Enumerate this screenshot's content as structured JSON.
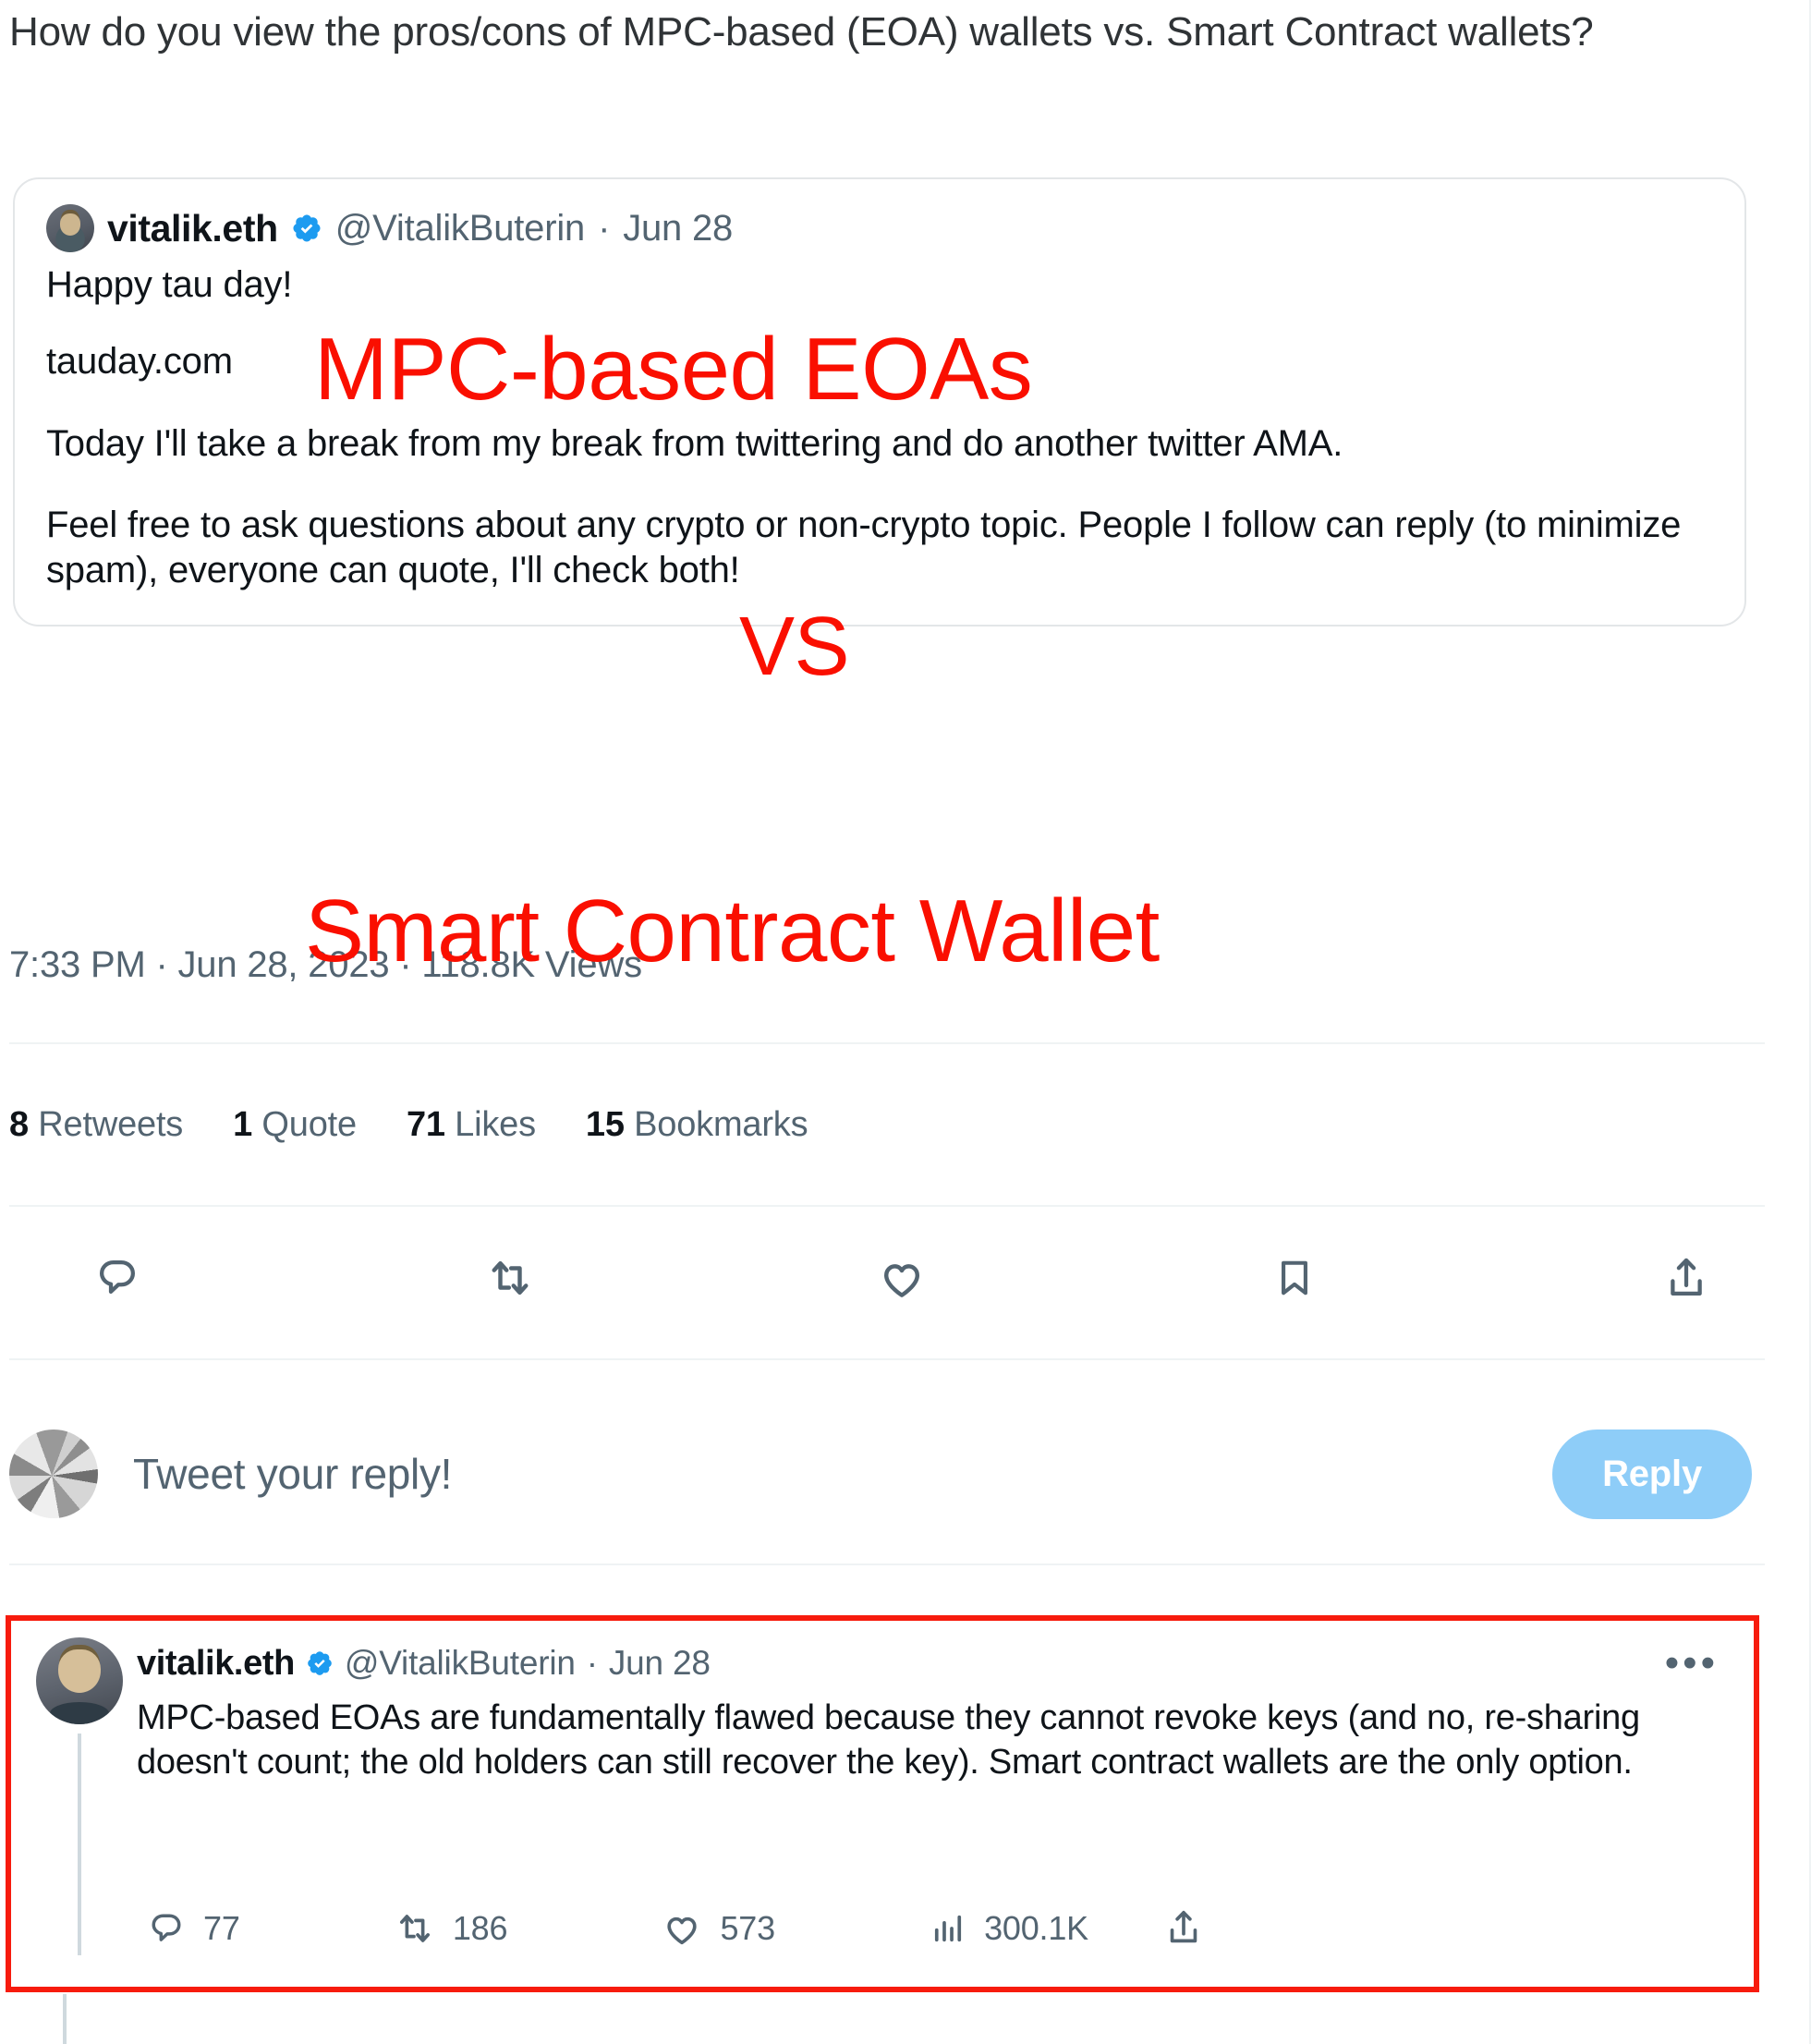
{
  "question": "How do you view the pros/cons of MPC-based (EOA) wallets vs. Smart Contract wallets?",
  "annotations": {
    "top": "MPC-based EOAs",
    "middle": "VS",
    "bottom": "Smart Contract Wallet",
    "color": "#fa0f00"
  },
  "quoted_tweet": {
    "display_name": "vitalik.eth",
    "verified_icon": "verified-badge-icon",
    "handle": "@VitalikButerin",
    "separator": "·",
    "date": "Jun 28",
    "line1": "Happy tau day!",
    "line2": "tauday.com",
    "line3": "Today I'll take a break from my break from twittering and do another twitter AMA.",
    "line4": "Feel free to ask questions about any crypto or non-crypto topic. People I follow can reply (to minimize spam), everyone can quote, I'll check both!"
  },
  "meta": {
    "timestamp": "7:33 PM · Jun 28, 2023 · 118.8K Views"
  },
  "stats": [
    {
      "count": "8",
      "label": "Retweets"
    },
    {
      "count": "1",
      "label": "Quote"
    },
    {
      "count": "71",
      "label": "Likes"
    },
    {
      "count": "15",
      "label": "Bookmarks"
    }
  ],
  "actions": [
    {
      "name": "reply-icon",
      "label": "Reply"
    },
    {
      "name": "retweet-icon",
      "label": "Retweet"
    },
    {
      "name": "like-icon",
      "label": "Like"
    },
    {
      "name": "bookmark-icon",
      "label": "Bookmark"
    },
    {
      "name": "share-icon",
      "label": "Share"
    }
  ],
  "composer": {
    "placeholder": "Tweet your reply!",
    "button_label": "Reply",
    "button_color": "#8ecdf8"
  },
  "reply_tweet": {
    "highlight_color": "#f71b0d",
    "display_name": "vitalik.eth",
    "verified_icon": "verified-badge-icon",
    "handle": "@VitalikButerin",
    "separator": "·",
    "date": "Jun 28",
    "more_menu": "•••",
    "text": "MPC-based EOAs are fundamentally flawed because they cannot revoke keys (and no, re-sharing doesn't count; the old holders can still recover the key). Smart contract wallets are the only option.",
    "metrics": {
      "replies": "77",
      "retweets": "186",
      "likes": "573",
      "views": "300.1K"
    }
  }
}
